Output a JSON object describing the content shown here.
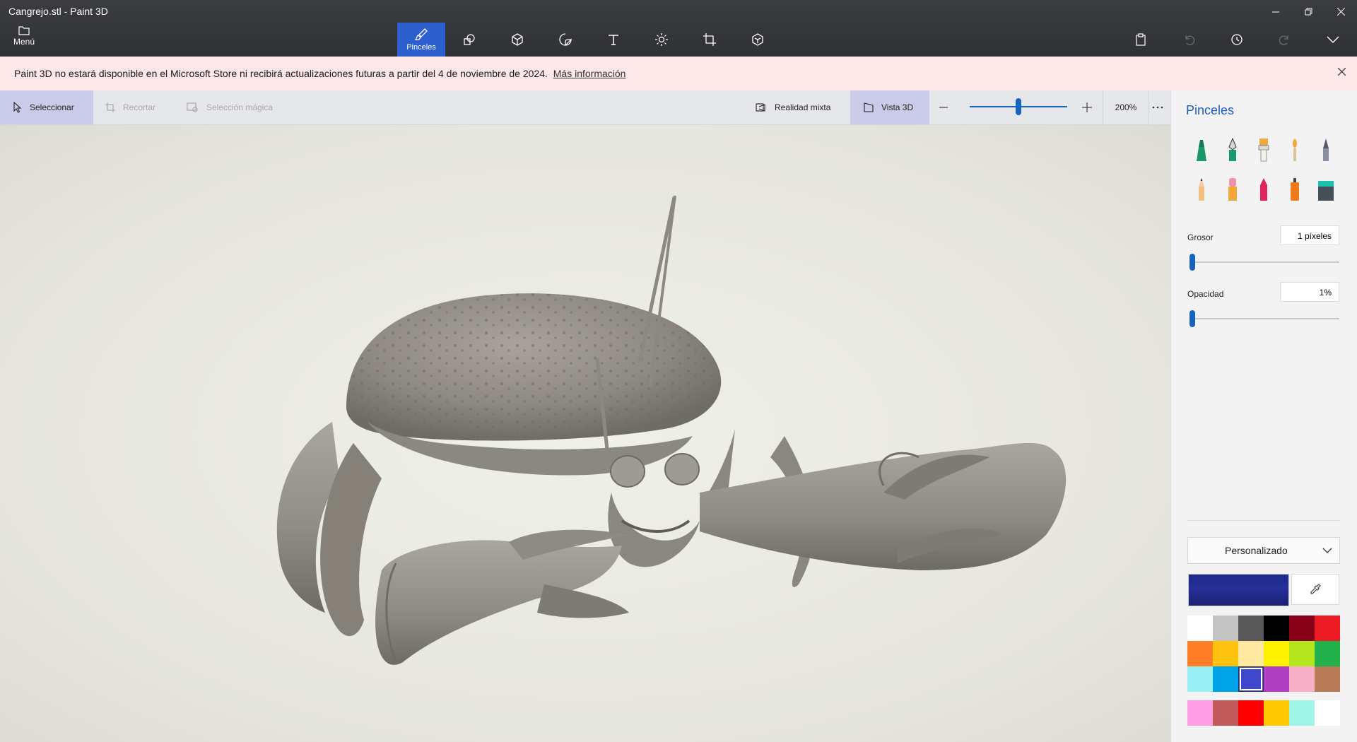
{
  "window": {
    "title": "Cangrejo.stl - Paint 3D"
  },
  "menu": {
    "label": "Menú"
  },
  "toolbar": {
    "tools": [
      {
        "name": "brushes",
        "label": "Pinceles",
        "active": true
      },
      {
        "name": "2d-shapes",
        "label": ""
      },
      {
        "name": "3d-shapes",
        "label": ""
      },
      {
        "name": "stickers",
        "label": ""
      },
      {
        "name": "text",
        "label": ""
      },
      {
        "name": "effects",
        "label": ""
      },
      {
        "name": "canvas",
        "label": ""
      },
      {
        "name": "3d-library",
        "label": ""
      }
    ]
  },
  "banner": {
    "text": "Paint 3D no estará disponible en el Microsoft Store ni recibirá actualizaciones futuras a partir del 4 de noviembre de 2024.",
    "link": "Más información"
  },
  "commandbar": {
    "select": "Seleccionar",
    "crop": "Recortar",
    "magic_select": "Selección mágica",
    "mixed_reality": "Realidad mixta",
    "view3d": "Vista 3D",
    "zoom": "200%",
    "zoom_level_fraction": 0.5
  },
  "panel": {
    "title": "Pinceles",
    "thickness_label": "Grosor",
    "thickness_value": "1 píxeles",
    "thickness_fraction": 0.0,
    "opacity_label": "Opacidad",
    "opacity_value": "1%",
    "opacity_fraction": 0.0,
    "palette_mode": "Personalizado",
    "current_color": "#25309a",
    "colors": [
      "#ffffff",
      "#c3c3c3",
      "#585858",
      "#000000",
      "#880015",
      "#ed1c24",
      "#ff7f27",
      "#ffc20e",
      "#ffe8a0",
      "#fff200",
      "#b5e61d",
      "#22b14c",
      "#99f0f5",
      "#00a2e8",
      "#3f48cc",
      "#b040c0",
      "#f6b0c8",
      "#b97a57"
    ],
    "selected_color_index": 14,
    "custom_colors": [
      "#ff9ee4",
      "#c05a5a",
      "#ff0000",
      "#ffc800",
      "#a0f5e6",
      "#ffffff"
    ]
  }
}
